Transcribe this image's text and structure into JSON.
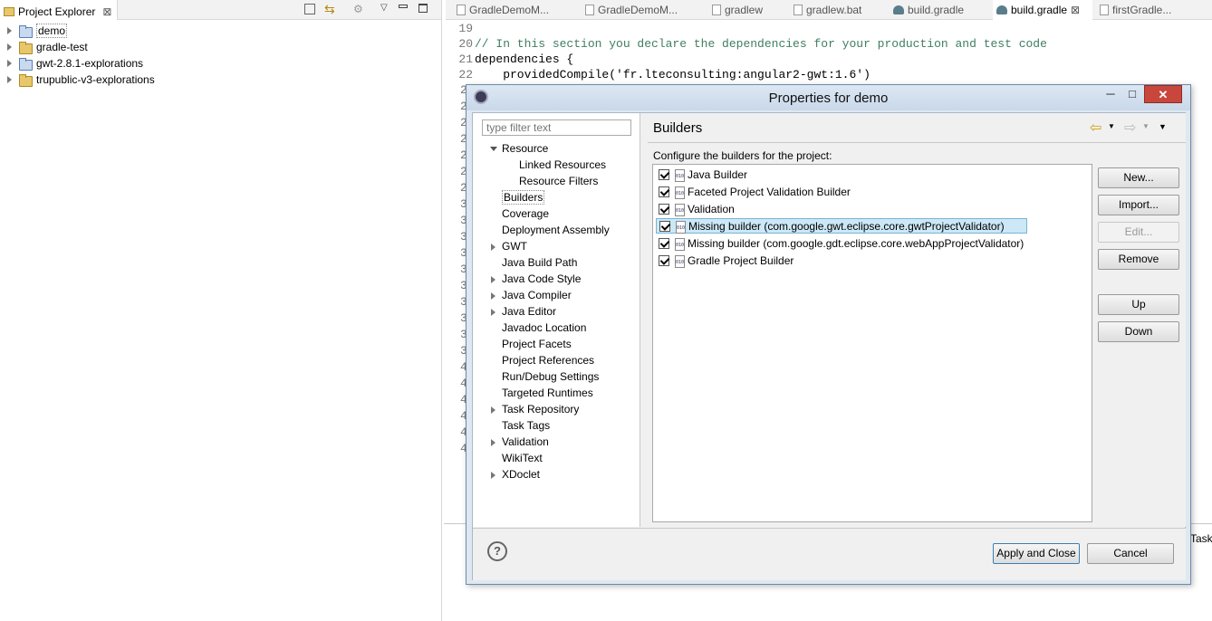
{
  "explorer": {
    "title": "Project Explorer",
    "items": [
      {
        "label": "demo",
        "type": "java"
      },
      {
        "label": "gradle-test",
        "type": "folder"
      },
      {
        "label": "gwt-2.8.1-explorations",
        "type": "java"
      },
      {
        "label": "trupublic-v3-explorations",
        "type": "folder"
      }
    ]
  },
  "editor": {
    "tabs": [
      "GradleDemoM...",
      "GradleDemoM...",
      "gradlew",
      "gradlew.bat",
      "build.gradle",
      "build.gradle",
      "firstGradle..."
    ],
    "lines": [
      {
        "n": "19",
        "text": ""
      },
      {
        "n": "20",
        "text": "// In this section you declare the dependencies for your production and test code"
      },
      {
        "n": "21",
        "text": "dependencies {"
      },
      {
        "n": "22",
        "text": "    providedCompile('fr.lteconsulting:angular2-gwt:1.6')"
      }
    ],
    "gutter_digits": [
      "2",
      "2",
      "2",
      "2",
      "2",
      "2",
      "2",
      "3",
      "3",
      "3",
      "3",
      "3",
      "3",
      "3",
      "3",
      "3",
      "3",
      "4",
      "4",
      "4",
      "4",
      "4",
      "4"
    ]
  },
  "dialog": {
    "title": "Properties for demo",
    "filter_placeholder": "type filter text",
    "nav": [
      {
        "label": "Resource",
        "twisty": "open",
        "indent": 0
      },
      {
        "label": "Linked Resources",
        "twisty": "none",
        "indent": 1
      },
      {
        "label": "Resource Filters",
        "twisty": "none",
        "indent": 1
      },
      {
        "label": "Builders",
        "twisty": "none",
        "indent": 0,
        "selected": true
      },
      {
        "label": "Coverage",
        "twisty": "none",
        "indent": 0
      },
      {
        "label": "Deployment Assembly",
        "twisty": "none",
        "indent": 0
      },
      {
        "label": "GWT",
        "twisty": "closed",
        "indent": 0
      },
      {
        "label": "Java Build Path",
        "twisty": "none",
        "indent": 0
      },
      {
        "label": "Java Code Style",
        "twisty": "closed",
        "indent": 0
      },
      {
        "label": "Java Compiler",
        "twisty": "closed",
        "indent": 0
      },
      {
        "label": "Java Editor",
        "twisty": "closed",
        "indent": 0
      },
      {
        "label": "Javadoc Location",
        "twisty": "none",
        "indent": 0
      },
      {
        "label": "Project Facets",
        "twisty": "none",
        "indent": 0
      },
      {
        "label": "Project References",
        "twisty": "none",
        "indent": 0
      },
      {
        "label": "Run/Debug Settings",
        "twisty": "none",
        "indent": 0
      },
      {
        "label": "Targeted Runtimes",
        "twisty": "none",
        "indent": 0
      },
      {
        "label": "Task Repository",
        "twisty": "closed",
        "indent": 0
      },
      {
        "label": "Task Tags",
        "twisty": "none",
        "indent": 0
      },
      {
        "label": "Validation",
        "twisty": "closed",
        "indent": 0
      },
      {
        "label": "WikiText",
        "twisty": "none",
        "indent": 0
      },
      {
        "label": "XDoclet",
        "twisty": "closed",
        "indent": 0
      }
    ],
    "page_title": "Builders",
    "description": "Configure the builders for the project:",
    "builders": [
      {
        "label": "Java Builder",
        "checked": true
      },
      {
        "label": "Faceted Project Validation Builder",
        "checked": true
      },
      {
        "label": "Validation",
        "checked": true
      },
      {
        "label": "Missing builder (com.google.gwt.eclipse.core.gwtProjectValidator)",
        "checked": true,
        "selected": true
      },
      {
        "label": "Missing builder (com.google.gdt.eclipse.core.webAppProjectValidator)",
        "checked": true
      },
      {
        "label": "Gradle Project Builder",
        "checked": true
      }
    ],
    "buttons": {
      "new": "New...",
      "import": "Import...",
      "edit": "Edit...",
      "remove": "Remove",
      "up": "Up",
      "down": "Down",
      "apply_close": "Apply and Close",
      "cancel": "Cancel",
      "help": "?"
    }
  },
  "right_edge_label": "Task"
}
